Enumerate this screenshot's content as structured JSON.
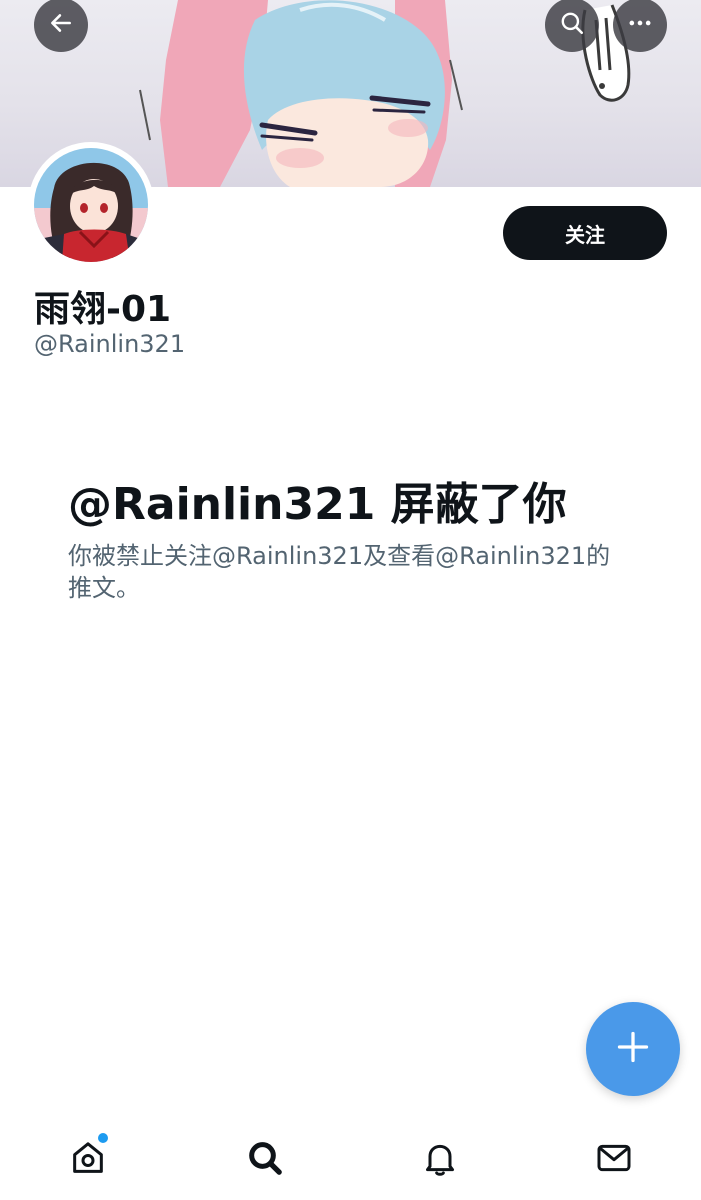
{
  "header": {
    "back_icon": "arrow-left-icon",
    "search_icon": "search-icon",
    "more_icon": "more-horizontal-icon"
  },
  "profile": {
    "display_name": "雨翎-01",
    "handle": "@Rainlin321",
    "follow_label": "关注"
  },
  "blocked": {
    "title": "@Rainlin321 屏蔽了你",
    "description": "你被禁止关注@Rainlin321及查看@Rainlin321的推文。"
  },
  "fab": {
    "icon": "plus-icon"
  },
  "bottom_nav": {
    "items": [
      {
        "icon": "home-icon",
        "has_notification": true
      },
      {
        "icon": "search-icon",
        "active": true
      },
      {
        "icon": "bell-icon"
      },
      {
        "icon": "mail-icon"
      }
    ]
  },
  "colors": {
    "primary_text": "#0f1419",
    "secondary_text": "#536471",
    "fab": "#4a99e9",
    "notification_dot": "#1d9bf0",
    "follow_button": "#0f1419"
  }
}
